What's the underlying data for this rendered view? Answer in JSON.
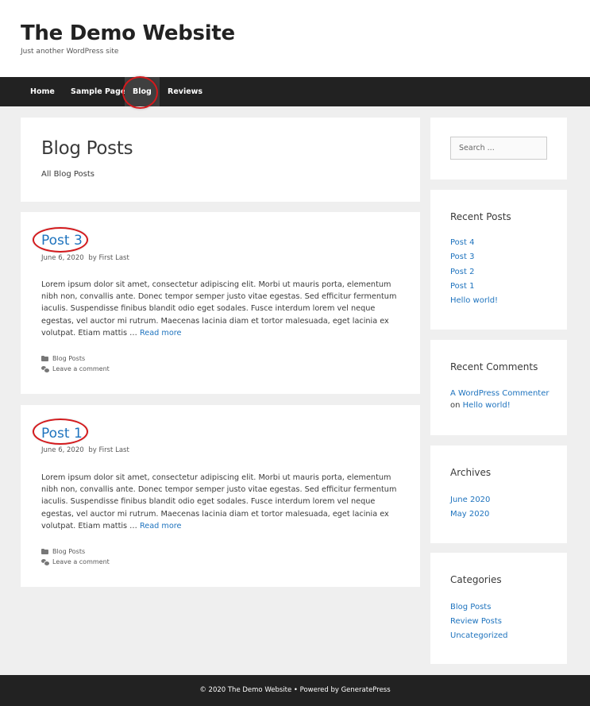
{
  "site": {
    "title": "The Demo Website",
    "tagline": "Just another WordPress site"
  },
  "nav": {
    "items": [
      {
        "label": "Home"
      },
      {
        "label": "Sample Page"
      },
      {
        "label": "Blog",
        "current": true
      },
      {
        "label": "Reviews"
      }
    ]
  },
  "archive": {
    "title": "Blog Posts",
    "description": "All Blog Posts"
  },
  "posts": [
    {
      "title": "Post 3",
      "date": "June 6, 2020",
      "by": "by",
      "author": "First Last",
      "excerpt": "Lorem ipsum dolor sit amet, consectetur adipiscing elit. Morbi ut mauris porta, elementum nibh non, convallis ante. Donec tempor semper justo vitae egestas. Sed efficitur fermentum iaculis. Suspendisse finibus blandit odio eget sodales. Fusce interdum lorem vel neque egestas, vel auctor mi rutrum. Maecenas lacinia diam et tortor malesuada, eget lacinia ex volutpat. Etiam mattis …",
      "read_more": "Read more",
      "category": "Blog Posts",
      "comment_link": "Leave a comment"
    },
    {
      "title": "Post 1",
      "date": "June 6, 2020",
      "by": "by",
      "author": "First Last",
      "excerpt": "Lorem ipsum dolor sit amet, consectetur adipiscing elit. Morbi ut mauris porta, elementum nibh non, convallis ante. Donec tempor semper justo vitae egestas. Sed efficitur fermentum iaculis. Suspendisse finibus blandit odio eget sodales. Fusce interdum lorem vel neque egestas, vel auctor mi rutrum. Maecenas lacinia diam et tortor malesuada, eget lacinia ex volutpat. Etiam mattis …",
      "read_more": "Read more",
      "category": "Blog Posts",
      "comment_link": "Leave a comment"
    }
  ],
  "sidebar": {
    "search": {
      "placeholder": "Search ..."
    },
    "recent_posts": {
      "title": "Recent Posts",
      "items": [
        "Post 4",
        "Post 3",
        "Post 2",
        "Post 1",
        "Hello world!"
      ]
    },
    "recent_comments": {
      "title": "Recent Comments",
      "author": "A WordPress Commenter",
      "on": "on",
      "post": "Hello world!"
    },
    "archives": {
      "title": "Archives",
      "items": [
        "June 2020",
        "May 2020"
      ]
    },
    "categories": {
      "title": "Categories",
      "items": [
        "Blog Posts",
        "Review Posts",
        "Uncategorized"
      ]
    }
  },
  "footer": {
    "text": "© 2020 The Demo Website • Powered by GeneratePress"
  },
  "colors": {
    "link": "#1e73be",
    "nav_bg": "#222222",
    "nav_current_bg": "#3f3f3f",
    "page_bg": "#efefef",
    "annotation": "#d3191c"
  }
}
